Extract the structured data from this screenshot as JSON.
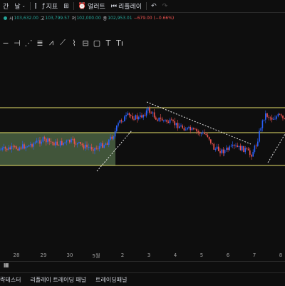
{
  "topbar": {
    "interval_prefix": "간",
    "interval": "날",
    "indicators": "지표",
    "alert": "얼러트",
    "replay": "리플레이"
  },
  "ohlc": {
    "open_label": "시",
    "open": "103,632.00",
    "high_label": "고",
    "high": "103,799.57",
    "low_label": "저",
    "low": "102,000.00",
    "close_label": "종",
    "close": "102,953.01",
    "change": "−679.00 (−0.66%)"
  },
  "colors": {
    "up": "#2962ff",
    "down": "#ef5350",
    "range_line": "#e6e06a",
    "range_fill": "#6b8f5e",
    "trend_line": "#e8e8e8"
  },
  "drawing_tools": [
    "minus-icon",
    "horizontal-line-icon",
    "rays-icon",
    "lines-icon",
    "pattern-icon",
    "zigzag-icon",
    "projection-icon",
    "measure-icon",
    "rectangle-icon",
    "text-icon",
    "text-tool-icon"
  ],
  "xaxis": {
    "labels": [
      "28",
      "29",
      "30",
      "5월",
      "2",
      "3",
      "4",
      "5",
      "6",
      "7",
      "8"
    ]
  },
  "bottom_tabs": [
    "략테스터",
    "리플레이 트레이딩 패널",
    "트레이딩패널"
  ]
}
